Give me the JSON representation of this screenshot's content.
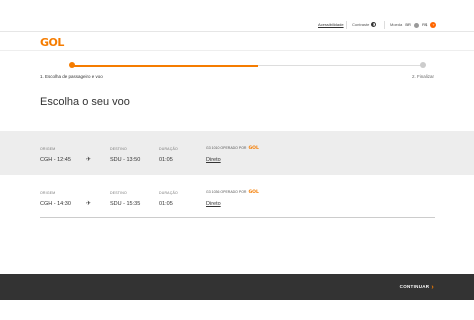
{
  "utility_bar": {
    "accessibility_label": "Acessibilidade",
    "contrast_label": "Contraste",
    "currency_label": "Moeda",
    "currency_options": [
      "BR",
      "R$"
    ]
  },
  "brand": {
    "logo_text": "GOL"
  },
  "progress": {
    "step1_label": "1. Escolha de passageiro e voo",
    "step2_label": "2. Finalizar",
    "fraction_complete": 0.53
  },
  "page": {
    "title": "Escolha o seu voo"
  },
  "column_headers": {
    "origin": "ORIGEM",
    "destination": "DESTINO",
    "duration": "DURAÇÃO"
  },
  "flights": [
    {
      "origin": "CGH - 12:45",
      "destination": "SDU - 13:50",
      "duration": "01:05",
      "operated_by": "G3 1010 OPERADO POR",
      "carrier": "GOL",
      "stops": "Direto"
    },
    {
      "origin": "CGH - 14:30",
      "destination": "SDU - 15:35",
      "duration": "01:05",
      "operated_by": "G3 1036 OPERADO POR",
      "carrier": "GOL",
      "stops": "Direto"
    }
  ],
  "footer": {
    "continue_label": "CONTINUAR"
  },
  "colors": {
    "accent": "#f57c00",
    "footer_bg": "#333333",
    "selected_row_bg": "#ededed"
  }
}
